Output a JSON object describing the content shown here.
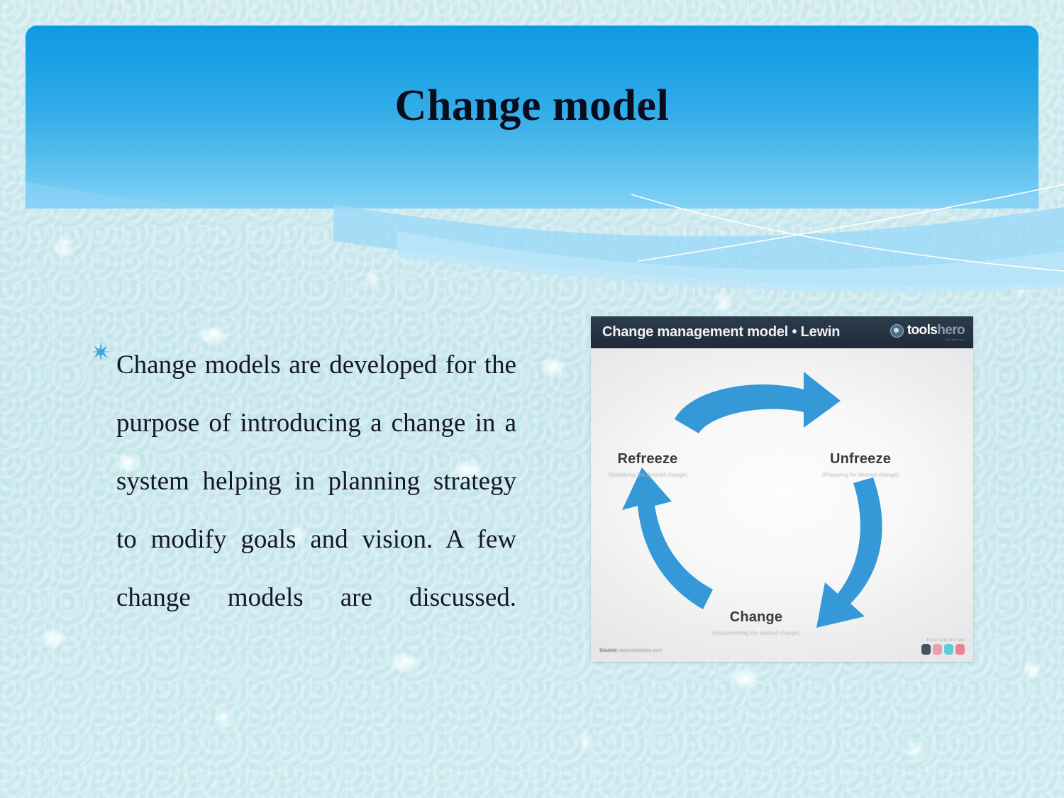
{
  "slide": {
    "title": "Change model",
    "bullet_icon": "six-point-star-bullet",
    "body_text": "Change models are developed for the purpose of introducing a change in a system helping in planning strategy to modify goals and vision. A few change models are discussed."
  },
  "picture": {
    "header_title": "Change management model • Lewin",
    "logo": {
      "mark": "toolshero-circle-icon",
      "primary": "tools",
      "secondary": "hero",
      "tagline": "toolshero.com"
    },
    "diagram": {
      "type": "cycle",
      "arrow_color": "#3499d6",
      "stages": [
        {
          "label": "Unfreeze",
          "subtitle": "(Preparing for desired change)"
        },
        {
          "label": "Change",
          "subtitle": "(Implementing the desired change)"
        },
        {
          "label": "Refreeze",
          "subtitle": "(Solidifying the desired change)"
        }
      ]
    },
    "source_label": "Source:",
    "source_value": "www.toolshero.com",
    "social_label": "FOLLOW US ON",
    "social_icons": [
      "facebook-icon",
      "instagram-icon",
      "twitter-icon",
      "pinterest-icon"
    ]
  },
  "colors": {
    "banner_top": "#0f9ae2",
    "banner_bottom": "#83d2f5",
    "background": "#c9e8ee",
    "bullet": "#3fa5dc",
    "title_text": "#080c1c",
    "body_text": "#141726",
    "picture_header": "#253242"
  }
}
